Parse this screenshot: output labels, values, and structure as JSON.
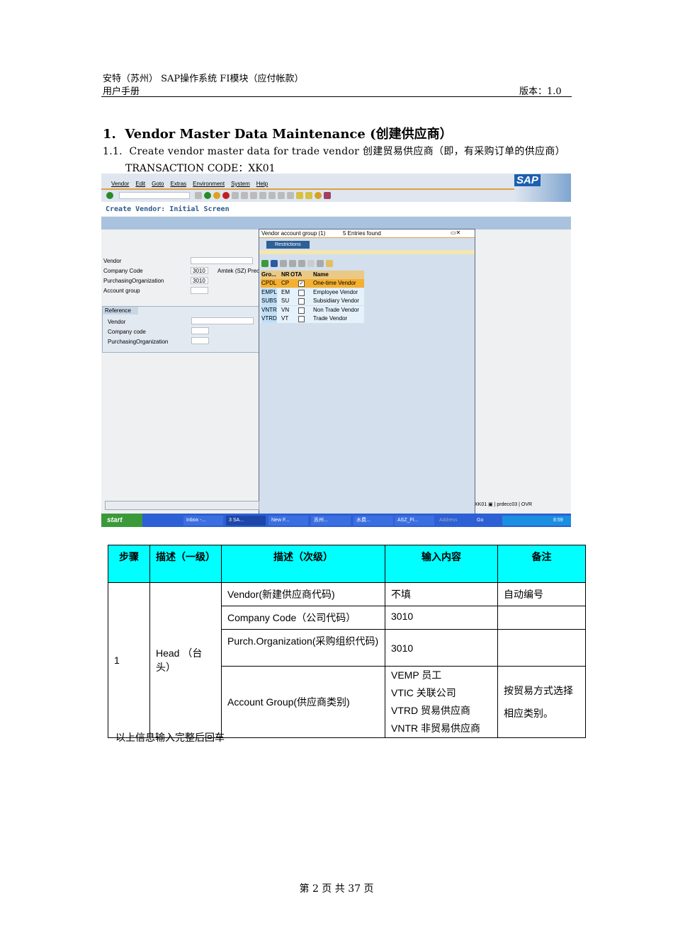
{
  "header": {
    "line1": "安特（苏州） SAP操作系统 FI模块（应付帐款）",
    "line2": "用户手册",
    "version": "版本：1.0"
  },
  "section": {
    "number": "1.",
    "title": "Vendor Master Data Maintenance (创建供应商）"
  },
  "subsection": {
    "number": "1.1.",
    "title": "Create vendor master data for trade vendor 创建贸易供应商（即，有采购订单的供应商）",
    "tcode": "TRANSACTION CODE：XK01"
  },
  "sap": {
    "menu": [
      "Vendor",
      "Edit",
      "Goto",
      "Extras",
      "Environment",
      "System",
      "Help"
    ],
    "logo": "SAP",
    "screen_title": "Create Vendor: Initial Screen",
    "fields": [
      {
        "label": "Vendor",
        "value": ""
      },
      {
        "label": "Company Code",
        "value": "3010",
        "desc": "Amtek (SZ) Prec"
      },
      {
        "label": "PurchasingOrganization",
        "value": "3010"
      },
      {
        "label": "Account group",
        "value": ""
      }
    ],
    "reference": {
      "title": "Reference",
      "fields": [
        {
          "label": "Vendor",
          "value": ""
        },
        {
          "label": "Company code",
          "value": ""
        },
        {
          "label": "PurchasingOrganization",
          "value": ""
        }
      ]
    },
    "popup": {
      "title": "Vendor account group (1)",
      "entries": "5 Entries found",
      "tab": "Restrictions",
      "columns": [
        "Gro...",
        "NR",
        "OTA",
        "Name"
      ],
      "rows": [
        {
          "group": "CPDL",
          "nr": "CP",
          "ota": true,
          "name": "One-time Vendor"
        },
        {
          "group": "EMPL",
          "nr": "EM",
          "ota": false,
          "name": "Employee Vendor"
        },
        {
          "group": "SUBS",
          "nr": "SU",
          "ota": false,
          "name": "Subsidiary Vendor"
        },
        {
          "group": "VNTR",
          "nr": "VN",
          "ota": false,
          "name": "Non Trade Vendor"
        },
        {
          "group": "VTRD",
          "nr": "VT",
          "ota": false,
          "name": "Trade Vendor"
        }
      ]
    },
    "status": {
      "tcode": "XK01",
      "server": "prdecc03",
      "mode": "OVR"
    },
    "taskbar": {
      "start": "start",
      "items": [
        "Inbox -...",
        "3 SA...",
        "New F...",
        "苏州...",
        "水费...",
        "ASZ_FI..."
      ],
      "address": "Address",
      "go": "Go",
      "clock": "8:59"
    }
  },
  "table": {
    "headers": [
      "步骤",
      "描述（一级）",
      "描述（次级）",
      "输入内容",
      "备注"
    ],
    "step": "1",
    "level1": "Head （台头）",
    "rows": [
      {
        "desc": "Vendor(新建供应商代码)",
        "input": "不填",
        "note": "自动编号"
      },
      {
        "desc": "Company Code（公司代码）",
        "input": "3010",
        "note": ""
      },
      {
        "desc": "Purch.Organization(采购组织代码)",
        "input": "3010",
        "note": ""
      },
      {
        "desc": "Account Group(供应商类别)",
        "inputs": [
          "VEMP  员工",
          "VTIC  关联公司",
          "VTRD  贸易供应商",
          "VNTR  非贸易供应商"
        ],
        "note": "按贸易方式选择相应类别。"
      }
    ],
    "footnote": "以上信息输入完整后回车"
  },
  "footer": {
    "page": "第 2 页 共 37 页"
  }
}
